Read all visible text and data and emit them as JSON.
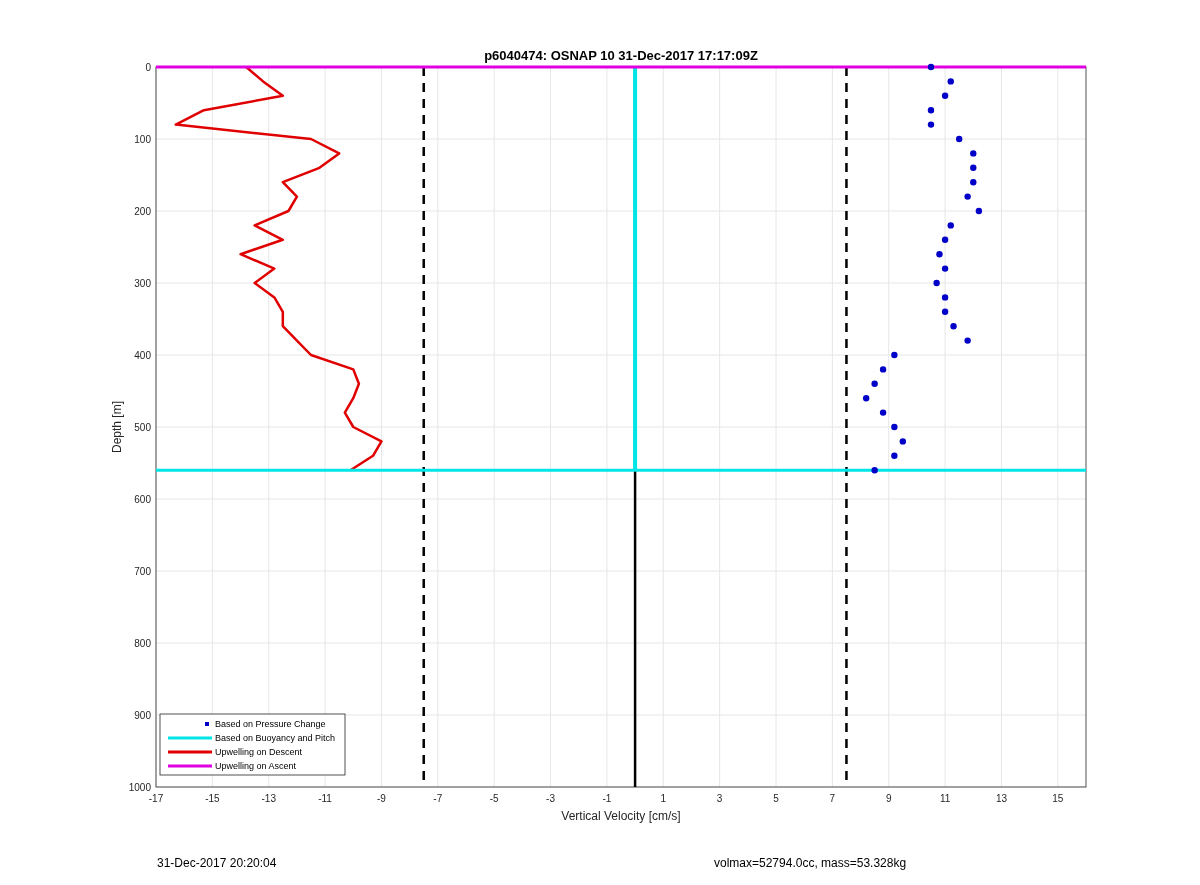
{
  "figure": {
    "chart_data": {
      "type": "line",
      "orientation": "horizontal",
      "title": "p6040474: OSNAP 10 31-Dec-2017 17:17:09Z",
      "xlabel": "Vertical Velocity [cm/s]",
      "ylabel": "Depth [m]",
      "xlim": [
        -17,
        16
      ],
      "ylim": [
        1000,
        0
      ],
      "grid": true,
      "legend": true,
      "xticks": [
        -17,
        -15,
        -13,
        -11,
        -9,
        -7,
        -5,
        -3,
        -1,
        1,
        3,
        5,
        7,
        9,
        11,
        13,
        15
      ],
      "yticks": [
        0,
        100,
        200,
        300,
        400,
        500,
        600,
        700,
        800,
        900,
        1000
      ],
      "x": [
        0,
        20,
        40,
        60,
        80,
        100,
        120,
        140,
        160,
        180,
        200,
        220,
        240,
        260,
        280,
        300,
        320,
        340,
        360,
        380,
        400,
        420,
        440,
        460,
        480,
        500,
        520,
        540,
        560
      ],
      "series": [
        {
          "name": "Based on Pressure Change",
          "type": "scatter",
          "color": "#0000c8",
          "values": [
            10.5,
            11.2,
            11,
            10.5,
            10.5,
            11.5,
            12,
            12,
            12,
            11.8,
            12.2,
            11.2,
            11,
            10.8,
            11,
            10.7,
            11,
            11,
            11.3,
            11.8,
            9.2,
            8.8,
            8.5,
            8.2,
            8.8,
            9.2,
            9.5,
            9.2,
            8.5
          ]
        },
        {
          "name": "Based on Buoyancy and Pitch",
          "type": "line",
          "color": "#00e5e5",
          "values": [
            0,
            0,
            0,
            0,
            0,
            0,
            0,
            0,
            0,
            0,
            0,
            0,
            0,
            0,
            0,
            0,
            0,
            0,
            0,
            0,
            0,
            0,
            0,
            0,
            0,
            0,
            0,
            0,
            0
          ]
        },
        {
          "name": "Upwelling on Descent",
          "type": "line",
          "color": "#e00000",
          "values": [
            -13.8,
            -13.2,
            -12.5,
            -15.3,
            -16.3,
            -11.5,
            -10.5,
            -11.2,
            -12.5,
            -12,
            -12.3,
            -13.5,
            -12.5,
            -14,
            -12.8,
            -13.5,
            -12.8,
            -12.5,
            -12.5,
            -12,
            -11.5,
            -10,
            -9.8,
            -10,
            -10.3,
            -10,
            -9,
            -9.3,
            -10.1
          ]
        },
        {
          "name": "Upwelling on Ascent",
          "type": "line",
          "color": "#e000e0",
          "values": [
            null,
            null,
            null,
            null,
            null,
            null,
            null,
            null,
            null,
            null,
            null,
            null,
            null,
            null,
            null,
            null,
            null,
            null,
            null,
            null,
            null,
            null,
            null,
            null,
            null,
            null,
            null,
            null,
            null
          ]
        }
      ],
      "ref_lines": [
        {
          "axis": "y",
          "value": 0,
          "color": "#e000e0"
        },
        {
          "axis": "y",
          "value": 560,
          "color": "#00e5e5"
        },
        {
          "axis": "x",
          "value": -7.5,
          "color": "#000000"
        },
        {
          "axis": "x",
          "value": 7.5,
          "color": "#000000"
        },
        {
          "axis": "x",
          "value": 0,
          "color": "#000000"
        }
      ]
    }
  },
  "footer": {
    "timestamp": "31-Dec-2017 20:20:04",
    "parameters": "volmax=52794.0cc, mass=53.328kg"
  }
}
